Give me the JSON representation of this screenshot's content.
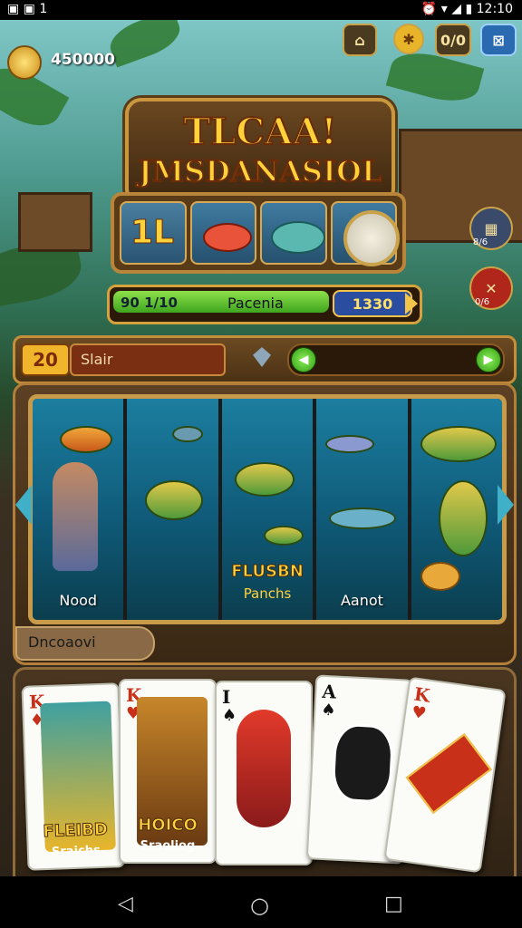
{
  "status": {
    "left": "▣ ▣ 1",
    "right": "⏰ ▾ ◢ ▮ 12:10"
  },
  "hud": {
    "coins": "450000",
    "btn_right1": "0/0",
    "btn_right2": "⊠"
  },
  "title": {
    "line1": "TLCAA!",
    "line2": "JMSDANASIOL"
  },
  "tiles": [
    "1L",
    "",
    "",
    ""
  ],
  "progress": {
    "left": "90 1/10",
    "label": "Pacenia",
    "value": "1330",
    "fill": 0.72
  },
  "side": {
    "top_label": "8/6",
    "bottom_label": "0/6"
  },
  "bar": {
    "level": "20",
    "search": "Slair",
    "buttons": [
      "◀",
      "▶"
    ]
  },
  "reels": {
    "labels": [
      "Nood",
      "",
      "",
      "Aanot",
      ""
    ],
    "center_line1": "FLUSBN",
    "center_line2": "Panchs"
  },
  "describe": "Dncoaovi",
  "cards": [
    {
      "rank": "K",
      "suit": "♦",
      "name1": "FLEIBD",
      "name2": "Sraichs",
      "color": "#e8b52a"
    },
    {
      "rank": "K",
      "suit": "♥",
      "name1": "HOICO",
      "name2": "Sraoliog",
      "color": "#c7862a"
    },
    {
      "rank": "I",
      "suit": "♠",
      "name1": "",
      "name2": "",
      "color": "#ffffff"
    },
    {
      "rank": "A",
      "suit": "♠",
      "name1": "",
      "name2": "",
      "color": "#ffffff"
    },
    {
      "rank": "K",
      "suit": "♥",
      "name1": "",
      "name2": "",
      "color": "#ffffff"
    }
  ],
  "nav": {
    "back": "◁",
    "home": "○",
    "recent": "□"
  }
}
